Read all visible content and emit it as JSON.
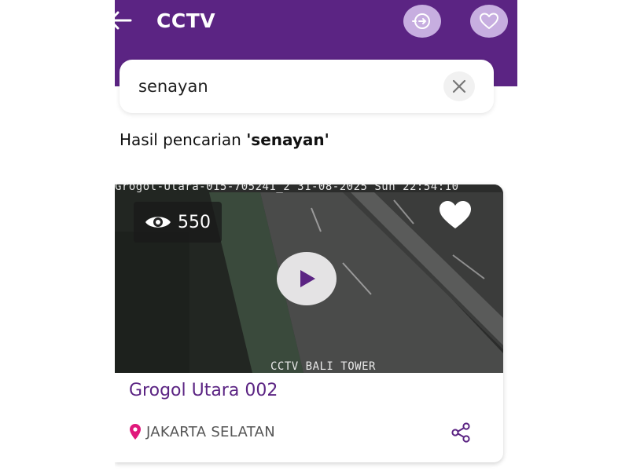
{
  "app_bar": {
    "title": "CCTV",
    "icons": {
      "back": "arrow-left-icon",
      "switch": "switch-view-icon",
      "favorite": "heart-outline-icon"
    },
    "color": "#5b2483"
  },
  "search": {
    "value": "senayan",
    "clear_icon": "close-icon"
  },
  "results": {
    "prefix": "Hasil pencarian ",
    "query": "'senayan'"
  },
  "card": {
    "feed": {
      "osd_top": "Grogol-Utara-015-705241_2   31-08-2025 Sun 22:54:10",
      "osd_bottom": "CCTV BALI TOWER"
    },
    "views": {
      "icon": "eye-icon",
      "count": "550"
    },
    "favorite_icon": "heart-filled-icon",
    "play_icon": "play-icon",
    "name": "Grogol Utara 002",
    "location": {
      "icon": "location-pin-icon",
      "label": "JAKARTA SELATAN",
      "pin_color": "#e0187b"
    },
    "share_icon": "share-icon"
  }
}
